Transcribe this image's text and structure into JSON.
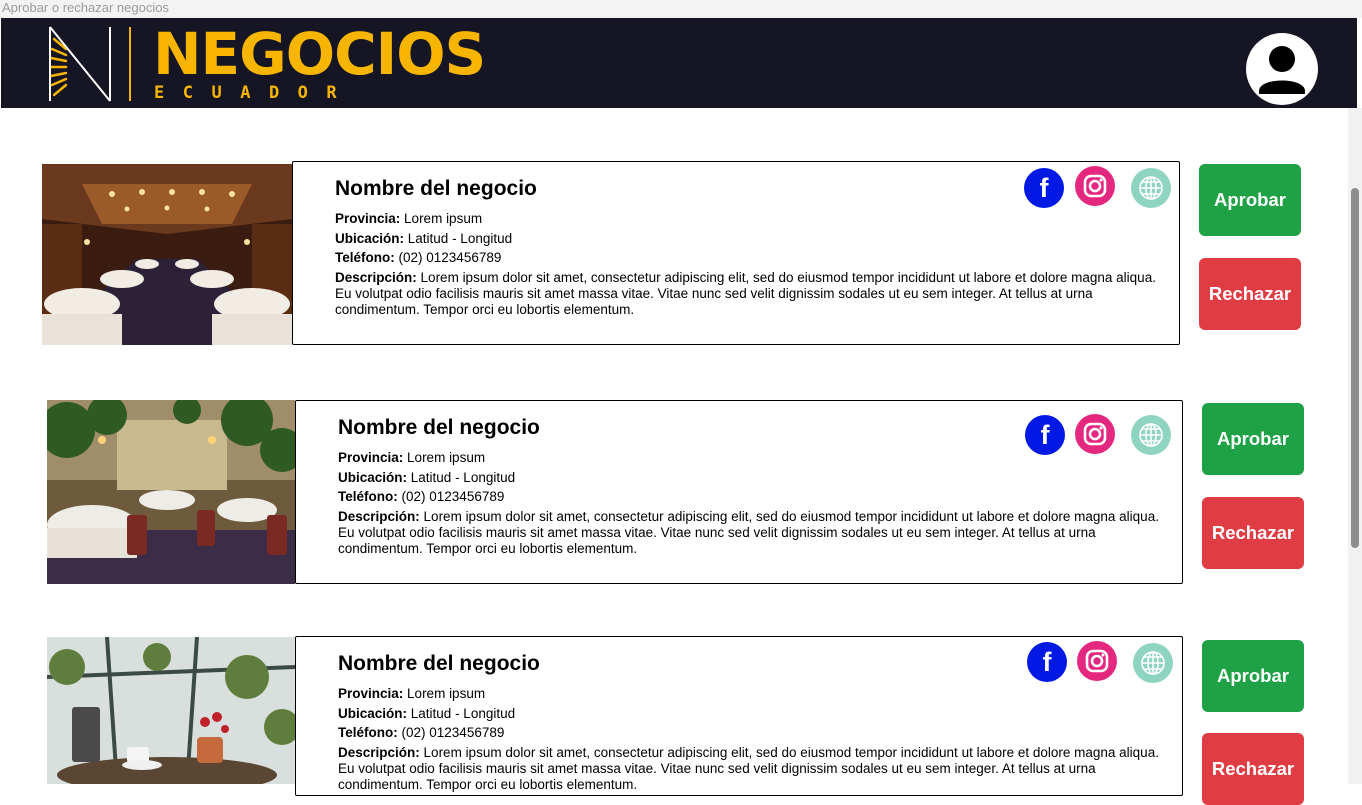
{
  "window": {
    "title": "Aprobar o rechazar negocios"
  },
  "header": {
    "logo_word": "NEGOCIOS",
    "logo_sub": "ECUADOR"
  },
  "colors": {
    "header_bg": "#151524",
    "brand": "#f7b500",
    "approve": "#1fa246",
    "reject": "#df3d43",
    "facebook": "#0019e5",
    "instagram": "#e5287f",
    "web": "#8fd3c1"
  },
  "labels": {
    "province": "Provincia:",
    "location": "Ubicación:",
    "phone": "Teléfono:",
    "description": "Descripción:"
  },
  "businesses": [
    {
      "name": "Nombre del negocio",
      "province": "Lorem ipsum",
      "location": "Latitud - Longitud",
      "phone": "(02) 0123456789",
      "description": "Lorem ipsum dolor sit amet, consectetur adipiscing elit, sed do eiusmod tempor incididunt ut labore et dolore magna aliqua. Eu volutpat odio facilisis mauris sit amet massa vitae. Vitae nunc sed velit dignissim sodales ut eu sem integer. At tellus at urna condimentum. Tempor orci eu lobortis elementum.",
      "approve_label": "Aprobar",
      "reject_label": "Rechazar",
      "photo": "restaurant-train-car-photo"
    },
    {
      "name": "Nombre del negocio",
      "province": "Lorem ipsum",
      "location": "Latitud - Longitud",
      "phone": "(02) 0123456789",
      "description": "Lorem ipsum dolor sit amet, consectetur adipiscing elit, sed do eiusmod tempor incididunt ut labore et dolore magna aliqua. Eu volutpat odio facilisis mauris sit amet massa vitae. Vitae nunc sed velit dignissim sodales ut eu sem integer. At tellus at urna condimentum. Tempor orci eu lobortis elementum.",
      "approve_label": "Aprobar",
      "reject_label": "Rechazar",
      "photo": "restaurant-dining-room-photo"
    },
    {
      "name": "Nombre del negocio",
      "province": "Lorem ipsum",
      "location": "Latitud - Longitud",
      "phone": "(02) 0123456789",
      "description": "Lorem ipsum dolor sit amet, consectetur adipiscing elit, sed do eiusmod tempor incididunt ut labore et dolore magna aliqua. Eu volutpat odio facilisis mauris sit amet massa vitae. Vitae nunc sed velit dignissim sodales ut eu sem integer. At tellus at urna condimentum. Tempor orci eu lobortis elementum.",
      "approve_label": "Aprobar",
      "reject_label": "Rechazar",
      "photo": "cafe-table-photo"
    }
  ]
}
